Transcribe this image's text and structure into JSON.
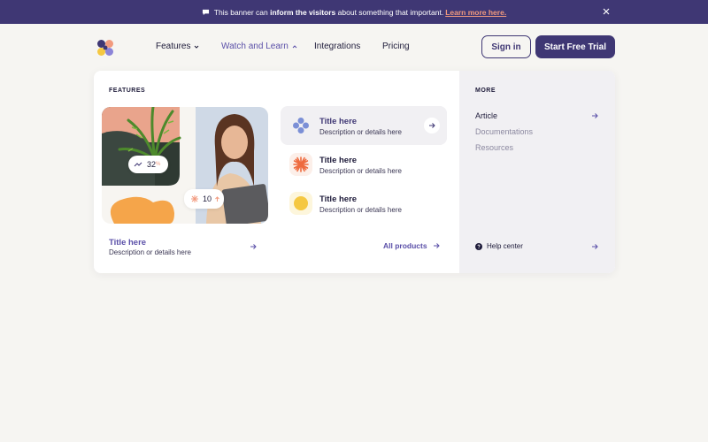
{
  "banner": {
    "text_before": "This banner can",
    "text_bold": "inform the visitors",
    "text_after": "about something that important.",
    "link": "Learn more here."
  },
  "nav": {
    "items": [
      {
        "label": "Features"
      },
      {
        "label": "Watch and Learn"
      },
      {
        "label": "Integrations"
      },
      {
        "label": "Pricing"
      }
    ],
    "signin": "Sign in",
    "trial": "Start Free Trial"
  },
  "dropdown": {
    "features_label": "FEATURES",
    "more_label": "MORE",
    "stats": {
      "growth": "32",
      "growth_unit": "%",
      "count": "10"
    },
    "cards": [
      {
        "title": "Title here",
        "desc": "Description or details here"
      },
      {
        "title": "Title here",
        "desc": "Description or details here"
      },
      {
        "title": "Title here",
        "desc": "Description or details here"
      }
    ],
    "bottom": {
      "title": "Title here",
      "desc": "Description or details here"
    },
    "all_products": "All products",
    "more_links": [
      "Article",
      "Documentations",
      "Resources"
    ],
    "help": "Help center"
  },
  "colors": {
    "brand": "#3f3774",
    "accent": "#5a4fa8",
    "link": "#f29a7e",
    "orange": "#f5a54a"
  }
}
